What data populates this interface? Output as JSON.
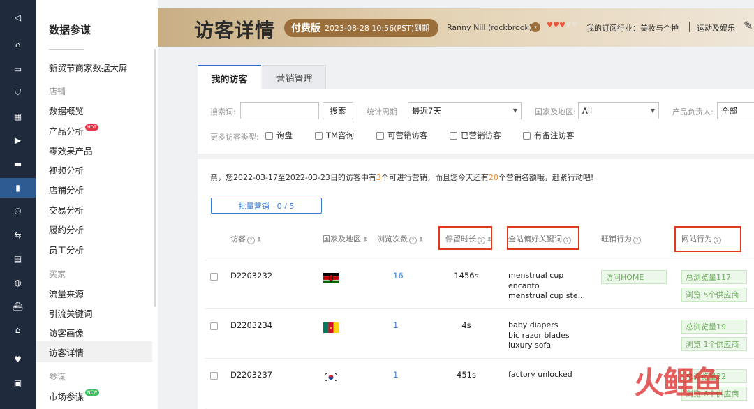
{
  "rail": [
    {
      "icon": "send-icon",
      "glyph": "◁"
    },
    {
      "icon": "home-icon",
      "glyph": "⌂"
    },
    {
      "icon": "store-icon",
      "glyph": "▭"
    },
    {
      "icon": "shield-icon",
      "glyph": "⛉"
    },
    {
      "icon": "grid-icon",
      "glyph": "▦"
    },
    {
      "icon": "video-icon",
      "glyph": "▶"
    },
    {
      "icon": "chat-icon",
      "glyph": "▬"
    },
    {
      "icon": "chart-icon",
      "glyph": "▮"
    },
    {
      "icon": "users-icon",
      "glyph": "⚇"
    },
    {
      "icon": "transfer-icon",
      "glyph": "⇆"
    },
    {
      "icon": "clipboard-icon",
      "glyph": "▤"
    },
    {
      "icon": "globe-icon",
      "glyph": "◍"
    },
    {
      "icon": "ship-icon",
      "glyph": "⛴"
    },
    {
      "icon": "bank-icon",
      "glyph": "⌂"
    },
    {
      "icon": "heart-icon",
      "glyph": "♥"
    },
    {
      "icon": "briefcase-icon",
      "glyph": "▣"
    }
  ],
  "sidebar": {
    "title": "数据参谋",
    "items": [
      {
        "label": "新贸节商家数据大屏",
        "type": "item"
      },
      {
        "label": "店铺",
        "type": "section"
      },
      {
        "label": "数据概览",
        "type": "item"
      },
      {
        "label": "产品分析",
        "type": "item",
        "badge": "HOT"
      },
      {
        "label": "零效果产品",
        "type": "item"
      },
      {
        "label": "视频分析",
        "type": "item"
      },
      {
        "label": "店铺分析",
        "type": "item"
      },
      {
        "label": "交易分析",
        "type": "item"
      },
      {
        "label": "履约分析",
        "type": "item"
      },
      {
        "label": "员工分析",
        "type": "item"
      },
      {
        "label": "买家",
        "type": "section"
      },
      {
        "label": "流量来源",
        "type": "item"
      },
      {
        "label": "引流关键词",
        "type": "item"
      },
      {
        "label": "访客画像",
        "type": "item"
      },
      {
        "label": "访客详情",
        "type": "item",
        "selected": true
      },
      {
        "label": "参谋",
        "type": "section"
      },
      {
        "label": "市场参谋",
        "type": "item",
        "badge": "NEW"
      }
    ]
  },
  "header": {
    "title": "访客详情",
    "paid_label": "付费版",
    "expiry": "2023-08-28 10:56(PST)到期",
    "user": "Ranny Nill (rockbrook)",
    "dropdown_glyph": "▾",
    "hearts": "♥♥♥♥♥",
    "industry": "我的订阅行业：美妆与个护",
    "category": "运动及娱乐",
    "edit_glyph": "✎"
  },
  "tabs": [
    "我的访客",
    "营销管理"
  ],
  "filters": {
    "search_label": "搜索词:",
    "search_value": "",
    "search_button": "搜索",
    "period_label": "统计周期",
    "period_value": "最近7天",
    "region_label": "国家及地区:",
    "region_value": "All",
    "owner_label": "产品负责人:",
    "owner_value": "全部",
    "more_label": "更多访客类型:",
    "checkboxes": [
      "询盘",
      "TM咨询",
      "可营销访客",
      "已营销访客",
      "有备注访客"
    ]
  },
  "notice": {
    "prefix": "亲，您2022-03-17至2022-03-23日的访客中有",
    "count": "3",
    "middle": "个可进行营销，而且您今天还有",
    "quota": "20",
    "suffix": "个营销名额哦，赶紧行动吧!"
  },
  "batch_button": "批量营销　0 / 5",
  "columns": {
    "visitor": "访客",
    "country": "国家及地区",
    "views": "浏览次数",
    "duration": "停留时长",
    "keywords": "全站偏好关键词",
    "store": "旺铺行为",
    "site": "网站行为",
    "help": "?",
    "sort": "⇕"
  },
  "rows": [
    {
      "id": "D2203232",
      "flag": "kenya",
      "views": "16",
      "duration": "1456s",
      "keywords": [
        "menstrual cup",
        "encanto",
        "menstrual cup ste..."
      ],
      "store_tag": "访问HOME",
      "site_tags": [
        "总浏览量117",
        "浏览 5个供应商"
      ]
    },
    {
      "id": "D2203234",
      "flag": "cameroon",
      "views": "1",
      "duration": "4s",
      "keywords": [
        "baby diapers",
        "bic razor blades",
        "luxury sofa"
      ],
      "store_tag": "",
      "site_tags": [
        "总浏览量19",
        "浏览 1个供应商"
      ]
    },
    {
      "id": "D2203237",
      "flag": "south-korea",
      "views": "1",
      "duration": "451s",
      "keywords": [
        "factory unlocked"
      ],
      "store_tag": "",
      "site_tags": [
        "总浏览量22",
        "浏览 6个供应商"
      ]
    }
  ],
  "watermark": "火鲤鱼",
  "colors": {
    "accent": "#2f6ed0",
    "highlight": "#e03a1e",
    "tag_green": "#6fae5f",
    "banner_gold": "#9b6f3c"
  }
}
